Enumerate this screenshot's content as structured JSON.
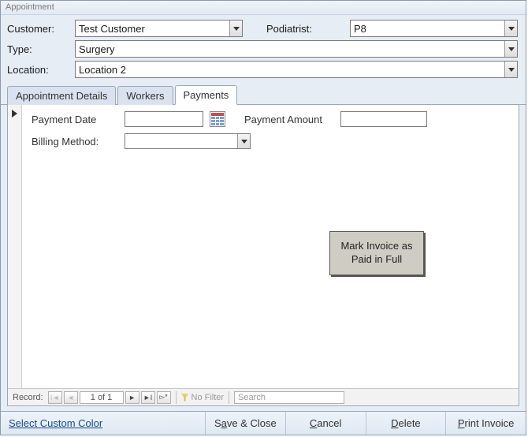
{
  "window": {
    "title": "Appointment"
  },
  "header": {
    "customer_label": "Customer:",
    "customer_value": "Test Customer",
    "podiatrist_label": "Podiatrist:",
    "podiatrist_value": "P8",
    "type_label": "Type:",
    "type_value": "Surgery",
    "location_label": "Location:",
    "location_value": "Location 2"
  },
  "tabs": [
    {
      "label": "Appointment Details",
      "active": false
    },
    {
      "label": "Workers",
      "active": false
    },
    {
      "label": "Payments",
      "active": true
    }
  ],
  "payments": {
    "payment_date_label": "Payment Date",
    "payment_date_value": "",
    "payment_amount_label": "Payment Amount",
    "payment_amount_value": "",
    "billing_method_label": "Billing Method:",
    "billing_method_value": "",
    "mark_paid_button": "Mark Invoice as Paid in Full"
  },
  "recnav": {
    "label": "Record:",
    "position": "1 of 1",
    "no_filter": "No Filter",
    "search_placeholder": "Search"
  },
  "footer": {
    "custom_color": "Select Custom Color",
    "save_close_pre": "S",
    "save_close_ul": "a",
    "save_close_post": "ve & Close",
    "cancel_ul": "C",
    "cancel_post": "ancel",
    "delete_ul": "D",
    "delete_post": "elete",
    "print_ul": "P",
    "print_post": "rint Invoice"
  }
}
